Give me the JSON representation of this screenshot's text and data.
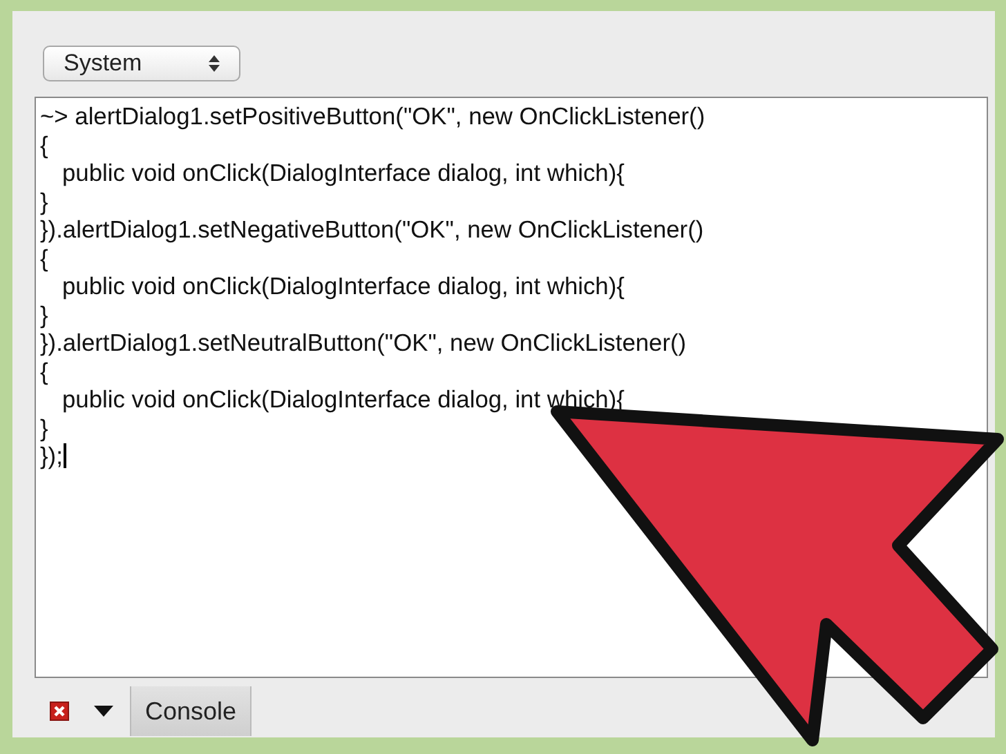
{
  "selector": {
    "value": "System"
  },
  "code_lines": [
    {
      "text": "~> alertDialog1.setPositiveButton(\"OK\", new OnClickListener()",
      "indented": false
    },
    {
      "text": "{",
      "indented": false
    },
    {
      "text": "public void onClick(DialogInterface dialog, int which){",
      "indented": true
    },
    {
      "text": "}",
      "indented": false
    },
    {
      "text": "}).alertDialog1.setNegativeButton(\"OK\", new OnClickListener()",
      "indented": false
    },
    {
      "text": "{",
      "indented": false
    },
    {
      "text": "public void onClick(DialogInterface dialog, int which){",
      "indented": true
    },
    {
      "text": "}",
      "indented": false
    },
    {
      "text": "}).alertDialog1.setNeutralButton(\"OK\", new OnClickListener()",
      "indented": false
    },
    {
      "text": "{",
      "indented": false
    },
    {
      "text": "public void onClick(DialogInterface dialog, int which){",
      "indented": true
    },
    {
      "text": "}",
      "indented": false
    },
    {
      "text": "});",
      "indented": false
    }
  ],
  "bottom_bar": {
    "tabs": [
      {
        "label": "Console",
        "selected": true
      }
    ]
  }
}
